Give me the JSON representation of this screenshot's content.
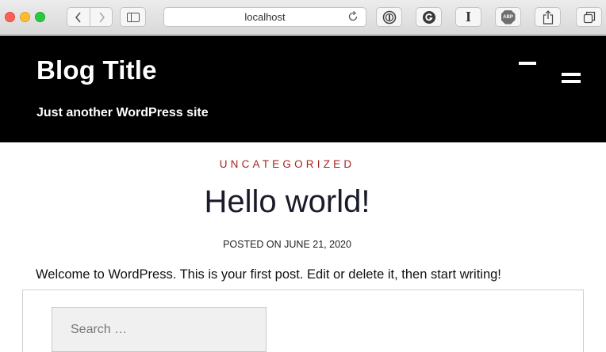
{
  "browser": {
    "address": "localhost",
    "icons": {
      "back": "chevron-left-icon",
      "forward": "chevron-right-icon",
      "sidebar": "sidebar-icon",
      "reload": "reload-icon",
      "ext1": "password-manager-icon",
      "ext2": "grammarly-icon",
      "ext3": "instapaper-icon",
      "ext4": "adblock-plus-icon",
      "share": "share-icon",
      "tabs": "tabs-overview-icon"
    },
    "ext3_glyph": "I",
    "abp_label": "ABP"
  },
  "site": {
    "title": "Blog Title",
    "tagline": "Just another WordPress site",
    "colors": {
      "header_bg": "#000000",
      "accent": "#a8211e"
    }
  },
  "post": {
    "category": "UNCATEGORIZED",
    "title": "Hello world!",
    "meta": "POSTED ON JUNE 21, 2020",
    "excerpt": "Welcome to WordPress. This is your first post. Edit or delete it, then start writing!"
  },
  "search": {
    "placeholder": "Search …",
    "value": ""
  }
}
